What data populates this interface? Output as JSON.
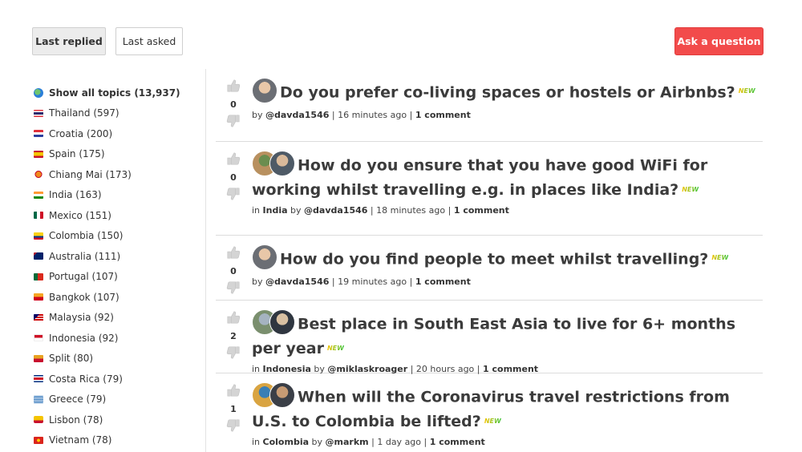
{
  "sort_tabs": {
    "last_replied": "Last replied",
    "last_asked": "Last asked"
  },
  "ask_button": "Ask a question",
  "colors": {
    "accent": "#f24b4b",
    "new_badge_from": "#f5c400",
    "new_badge_to": "#3cc43c"
  },
  "topics": [
    {
      "label": "Show all topics (13,937)",
      "icon": "globe-icon"
    },
    {
      "label": "Thailand (597)",
      "icon": "thailand-flag-icon"
    },
    {
      "label": "Croatia (200)",
      "icon": "croatia-flag-icon"
    },
    {
      "label": "Spain (175)",
      "icon": "spain-flag-icon"
    },
    {
      "label": "Chiang Mai (173)",
      "icon": "lantern-icon"
    },
    {
      "label": "India (163)",
      "icon": "india-flag-icon"
    },
    {
      "label": "Mexico (151)",
      "icon": "mexico-flag-icon"
    },
    {
      "label": "Colombia (150)",
      "icon": "colombia-flag-icon"
    },
    {
      "label": "Australia (111)",
      "icon": "australia-flag-icon"
    },
    {
      "label": "Portugal (107)",
      "icon": "portugal-flag-icon"
    },
    {
      "label": "Bangkok (107)",
      "icon": "temple-icon"
    },
    {
      "label": "Malaysia (92)",
      "icon": "malaysia-flag-icon"
    },
    {
      "label": "Indonesia (92)",
      "icon": "indonesia-flag-icon"
    },
    {
      "label": "Split (80)",
      "icon": "split-icon"
    },
    {
      "label": "Costa Rica (79)",
      "icon": "costa-rica-flag-icon"
    },
    {
      "label": "Greece (79)",
      "icon": "greece-flag-icon"
    },
    {
      "label": "Lisbon (78)",
      "icon": "tram-icon"
    },
    {
      "label": "Vietnam (78)",
      "icon": "vietnam-flag-icon"
    }
  ],
  "questions": [
    {
      "title": "Do you prefer co-living spaces or hostels or Airbnbs?",
      "new": "NEW",
      "votes": "0",
      "location": "",
      "author": "@davda1546",
      "time": "16 minutes ago",
      "comments": "1 comment"
    },
    {
      "title": "How do you ensure that you have good WiFi for working whilst travelling e.g. in places like India?",
      "new": "NEW",
      "votes": "0",
      "location": "India",
      "author": "@davda1546",
      "time": "18 minutes ago",
      "comments": "1 comment"
    },
    {
      "title": "How do you find people to meet whilst travelling?",
      "new": "NEW",
      "votes": "0",
      "location": "",
      "author": "@davda1546",
      "time": "19 minutes ago",
      "comments": "1 comment"
    },
    {
      "title": "Best place in South East Asia to live for 6+ months per year",
      "new": "NEW",
      "votes": "2",
      "location": "Indonesia",
      "author": "@miklaskroager",
      "time": "20 hours ago",
      "comments": "1 comment"
    },
    {
      "title": "When will the Coronavirus travel restrictions from U.S. to Colombia be lifted?",
      "new": "NEW",
      "votes": "1",
      "location": "Colombia",
      "author": "@markm",
      "time": "1 day ago",
      "comments": "1 comment"
    }
  ],
  "meta_words": {
    "by": "by",
    "in": "in",
    "sep": "|"
  }
}
